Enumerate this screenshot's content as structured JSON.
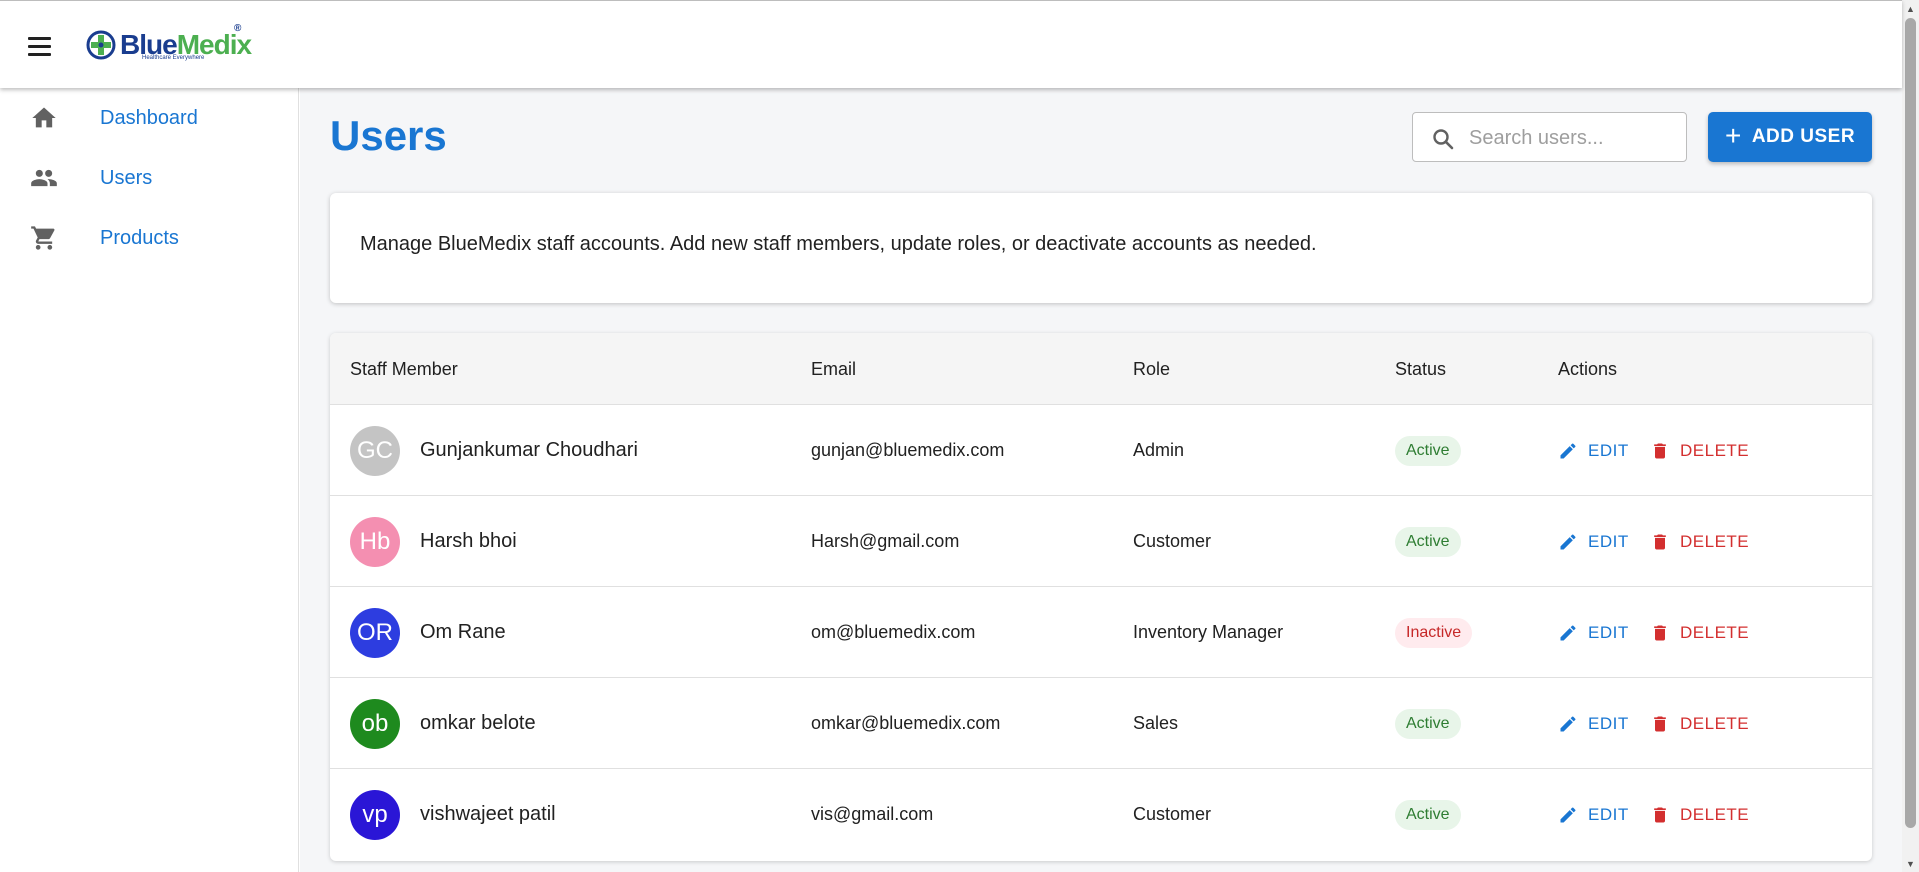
{
  "app": {
    "logo_part1": "Blue",
    "logo_part2": "Medix",
    "logo_reg": "®",
    "logo_tagline": "Healthcare Everywhere"
  },
  "sidebar": {
    "items": [
      {
        "label": "Dashboard",
        "icon": "home-icon"
      },
      {
        "label": "Users",
        "icon": "people-icon"
      },
      {
        "label": "Products",
        "icon": "cart-icon"
      }
    ]
  },
  "header": {
    "title": "Users",
    "search_placeholder": "Search users...",
    "add_button": "ADD USER"
  },
  "info": {
    "text": "Manage BlueMedix staff accounts. Add new staff members, update roles, or deactivate accounts as needed."
  },
  "table": {
    "columns": [
      "Staff Member",
      "Email",
      "Role",
      "Status",
      "Actions"
    ],
    "edit_label": "EDIT",
    "delete_label": "DELETE",
    "rows": [
      {
        "initials": "GC",
        "avatar_color": "#c4c4c4",
        "name": "Gunjankumar Choudhari",
        "email": "gunjan@bluemedix.com",
        "role": "Admin",
        "status": "Active"
      },
      {
        "initials": "Hb",
        "avatar_color": "#f48fb1",
        "name": "Harsh bhoi",
        "email": "Harsh@gmail.com",
        "role": "Customer",
        "status": "Active"
      },
      {
        "initials": "OR",
        "avatar_color": "#2d3de0",
        "name": "Om Rane",
        "email": "om@bluemedix.com",
        "role": "Inventory Manager",
        "status": "Inactive"
      },
      {
        "initials": "ob",
        "avatar_color": "#1e8a1e",
        "name": "omkar belote",
        "email": "omkar@bluemedix.com",
        "role": "Sales",
        "status": "Active"
      },
      {
        "initials": "vp",
        "avatar_color": "#2a16d6",
        "name": "vishwajeet patil",
        "email": "vis@gmail.com",
        "role": "Customer",
        "status": "Active"
      }
    ]
  },
  "colors": {
    "primary": "#1976d2",
    "danger": "#d32f2f",
    "active_bg": "#e8f5e9",
    "active_fg": "#2e7d32",
    "inactive_bg": "#ffebee",
    "inactive_fg": "#c62828"
  }
}
